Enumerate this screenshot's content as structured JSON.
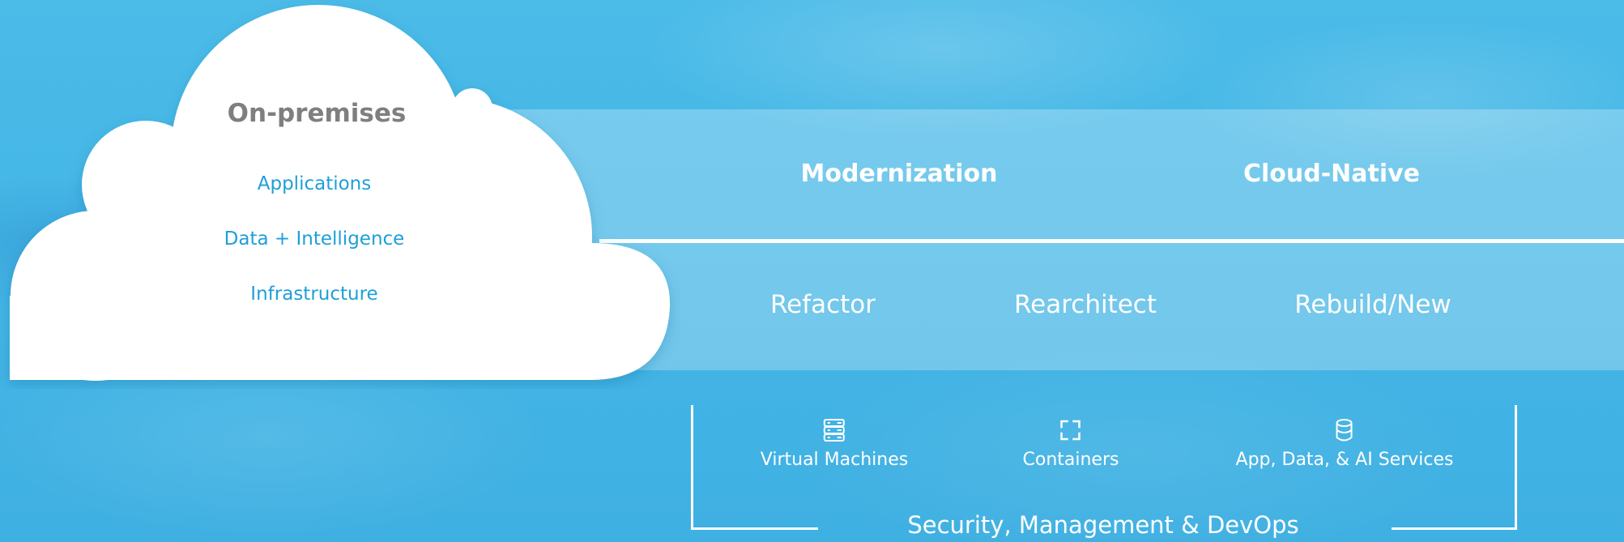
{
  "cloud": {
    "title": "On-premises",
    "items": [
      "Applications",
      "Data + Intelligence",
      "Infrastructure"
    ]
  },
  "band": {
    "headings": [
      "Modernization",
      "Cloud-Native"
    ],
    "steps": [
      "Refactor",
      "Rearchitect",
      "Rebuild/New"
    ]
  },
  "services": [
    {
      "label": "Virtual Machines",
      "icon": "server-icon"
    },
    {
      "label": "Containers",
      "icon": "container-frame-icon"
    },
    {
      "label": "App, Data, & AI Services",
      "icon": "database-icon"
    }
  ],
  "footer": {
    "caption": "Security, Management & DevOps"
  },
  "colors": {
    "background": "#44b6e6",
    "band": "rgba(255,255,255,0.26)",
    "cloud": "#ffffff",
    "cloud_title": "#7f7f7f",
    "cloud_items": "#1e9fd8",
    "text": "#ffffff"
  }
}
